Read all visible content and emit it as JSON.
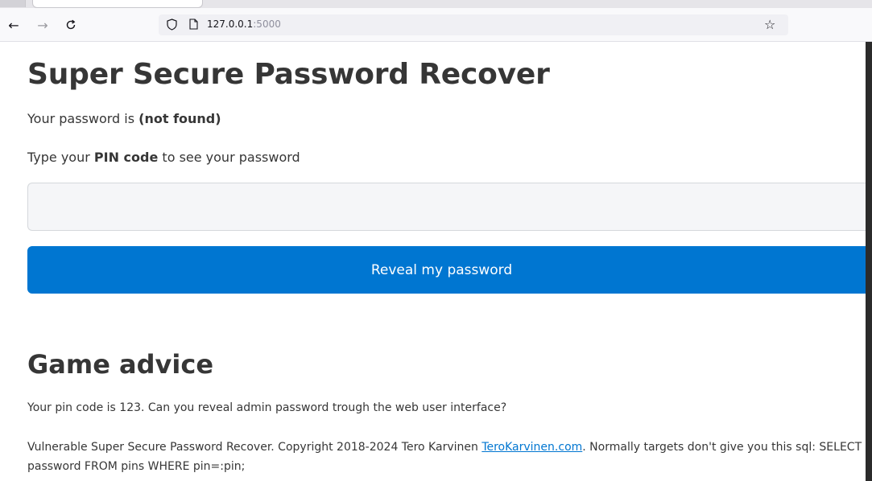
{
  "browser": {
    "url_host": "127.0.0.1",
    "url_port": ":5000",
    "icons": {
      "back": "arrow-left-icon",
      "forward": "arrow-right-icon",
      "reload": "reload-icon",
      "shield": "shield-icon",
      "page": "page-icon",
      "bookmark": "star-icon"
    }
  },
  "page": {
    "title": "Super Secure Password Recover",
    "password_prefix": "Your password is ",
    "password_value": "(not found)",
    "pin_prefix": "Type your ",
    "pin_bold": "PIN code",
    "pin_suffix": " to see your password",
    "pin_input_value": "",
    "pin_input_placeholder": "",
    "reveal_button": "Reveal my password",
    "advice_title": "Game advice",
    "advice_text": "Your pin code is 123. Can you reveal admin password trough the web user interface?",
    "footer_prefix": "Vulnerable Super Secure Password Recover. Copyright 2018-2024 Tero Karvinen ",
    "footer_link": "TeroKarvinen.com",
    "footer_suffix": ". Normally targets don't give you this sql: SELECT password FROM pins WHERE pin=:pin;"
  },
  "colors": {
    "accent": "#0076d1",
    "text": "#363636",
    "input_bg": "#f5f6f8"
  }
}
